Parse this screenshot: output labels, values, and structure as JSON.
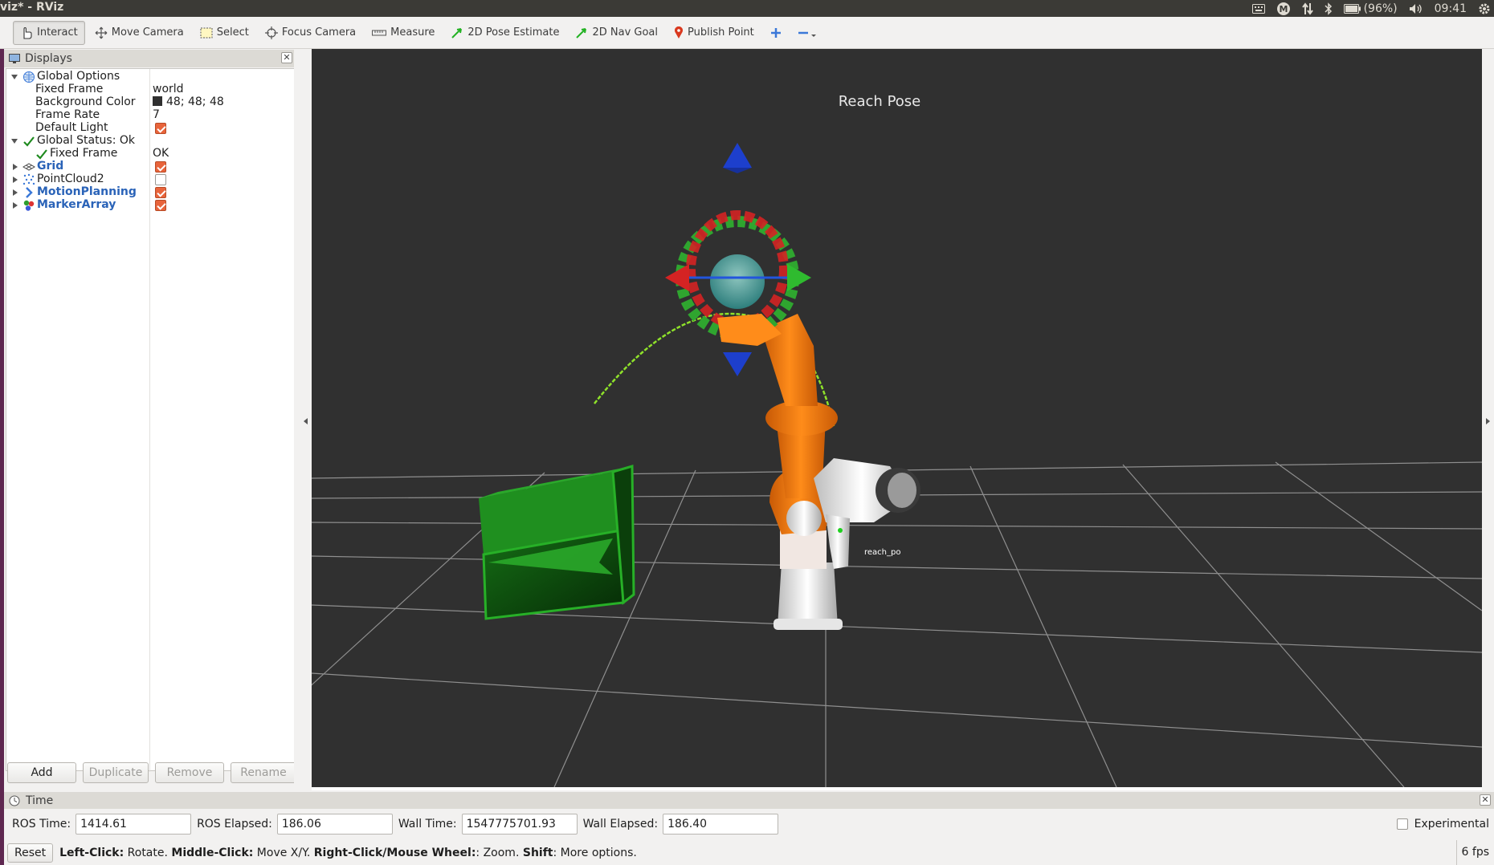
{
  "window": {
    "title": "viz* - RViz"
  },
  "tray": {
    "battery": "(96%)",
    "clock": "09:41"
  },
  "toolbar": {
    "tools": [
      {
        "label": "Interact",
        "icon": "hand-pointer-icon"
      },
      {
        "label": "Move Camera",
        "icon": "move-camera-icon"
      },
      {
        "label": "Select",
        "icon": "select-box-icon"
      },
      {
        "label": "Focus Camera",
        "icon": "focus-target-icon"
      },
      {
        "label": "Measure",
        "icon": "ruler-icon"
      },
      {
        "label": "2D Pose Estimate",
        "icon": "green-arrow-icon"
      },
      {
        "label": "2D Nav Goal",
        "icon": "green-arrow-icon"
      },
      {
        "label": "Publish Point",
        "icon": "map-pin-icon"
      }
    ]
  },
  "displays": {
    "title": "Displays",
    "rows": [
      {
        "name": "Global Options"
      },
      {
        "name": "Fixed Frame",
        "value": "world"
      },
      {
        "name": "Background Color",
        "value": "48; 48; 48"
      },
      {
        "name": "Frame Rate",
        "value": "7"
      },
      {
        "name": "Default Light",
        "checked": true
      },
      {
        "name": "Global Status: Ok"
      },
      {
        "name": "Fixed Frame",
        "value": "OK"
      },
      {
        "name": "Grid",
        "checked": true
      },
      {
        "name": "PointCloud2",
        "checked": false
      },
      {
        "name": "MotionPlanning",
        "checked": true
      },
      {
        "name": "MarkerArray",
        "checked": true
      }
    ],
    "buttons": {
      "add": "Add",
      "duplicate": "Duplicate",
      "remove": "Remove",
      "rename": "Rename"
    }
  },
  "viewport": {
    "overlay_title": "Reach  Pose",
    "marker_label": "reach_po",
    "background_color": "#303030"
  },
  "time": {
    "title": "Time",
    "ros_time_label": "ROS Time:",
    "ros_time": "1414.61",
    "ros_elapsed_label": "ROS Elapsed:",
    "ros_elapsed": "186.06",
    "wall_time_label": "Wall Time:",
    "wall_time": "1547775701.93",
    "wall_elapsed_label": "Wall Elapsed:",
    "wall_elapsed": "186.40",
    "experimental_label": "Experimental"
  },
  "status": {
    "reset_label": "Reset",
    "left_click": "Left-Click:",
    "left_click_action": " Rotate. ",
    "middle_click": "Middle-Click:",
    "middle_click_action": " Move X/Y. ",
    "right_click": "Right-Click/Mouse Wheel:",
    "right_click_action": ": Zoom. ",
    "shift": "Shift",
    "shift_action": ": More options.",
    "fps": "6 fps"
  },
  "colors": {
    "accent_orange": "#e8643b",
    "robot_orange": "#f07d18",
    "link_blue": "#2a63b8",
    "box_green": "#1c7a1c"
  }
}
